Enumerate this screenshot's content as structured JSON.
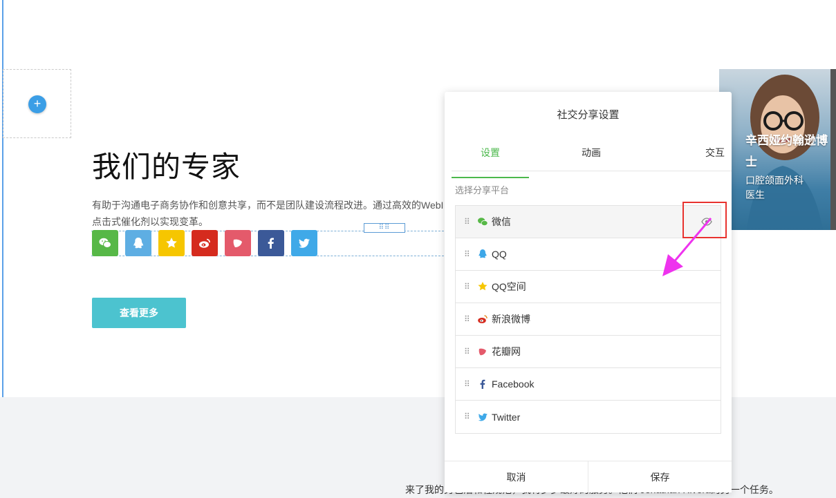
{
  "page": {
    "heading": "我们的专家",
    "description": "有助于沟通电子商务协作和创意共享，而不是团队建设流程改进。通过高效的WebI 点击式催化剂以实现变革。",
    "handle_dots": "⠿⠿",
    "more_button": "查看更多",
    "add_icon": "+",
    "bottom_text": "来了我的另包活和程规范，我将罗罗最好的服务。他们 Jonathan Rivera的另一个任务。"
  },
  "profile": {
    "name": "辛西娅约翰逊博士",
    "role": "口腔颌面外科医生"
  },
  "share_icons": [
    {
      "name": "wechat",
      "color": "#57b847"
    },
    {
      "name": "qq",
      "color": "#5eaee3"
    },
    {
      "name": "qzone",
      "color": "#f6c600"
    },
    {
      "name": "weibo",
      "color": "#d52b1e"
    },
    {
      "name": "huaban",
      "color": "#e45a6b"
    },
    {
      "name": "facebook",
      "color": "#3b5998"
    },
    {
      "name": "twitter",
      "color": "#3fa9e8"
    }
  ],
  "panel": {
    "title": "社交分享设置",
    "tabs": [
      "设置",
      "动画",
      "交互"
    ],
    "section_label": "选择分享平台",
    "platforms": [
      {
        "label": "微信",
        "icon": "wechat-icon",
        "color": "#57b847"
      },
      {
        "label": "QQ",
        "icon": "qq-icon",
        "color": "#5eaee3"
      },
      {
        "label": "QQ空间",
        "icon": "qzone-icon",
        "color": "#f6c600"
      },
      {
        "label": "新浪微博",
        "icon": "weibo-icon",
        "color": "#d52b1e"
      },
      {
        "label": "花瓣网",
        "icon": "huaban-icon",
        "color": "#e45a6b"
      },
      {
        "label": "Facebook",
        "icon": "facebook-icon",
        "color": "#3b5998"
      },
      {
        "label": "Twitter",
        "icon": "twitter-icon",
        "color": "#3fa9e8"
      }
    ],
    "cancel_label": "取消",
    "save_label": "保存"
  },
  "annotation": {
    "highlight_color": "#e8322e",
    "arrow_color": "#ee33ee"
  }
}
